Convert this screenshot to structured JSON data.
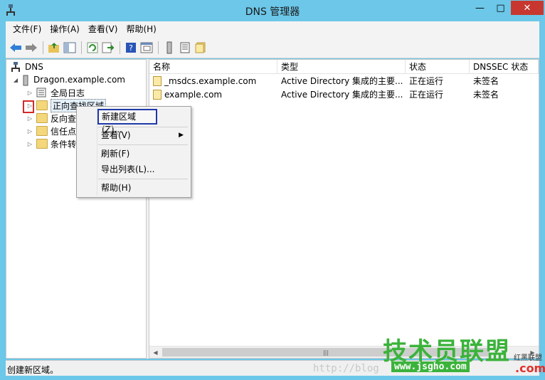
{
  "window": {
    "title": "DNS 管理器",
    "minimize": "—",
    "maximize": "□",
    "close": "✕"
  },
  "menubar": {
    "items": [
      "文件(F)",
      "操作(A)",
      "查看(V)",
      "帮助(H)"
    ]
  },
  "toolbar": {
    "icons": [
      "back-icon",
      "forward-icon",
      "up-folder-icon",
      "show-hide-tree-icon",
      "refresh-icon",
      "export-list-icon",
      "help-icon",
      "properties-icon",
      "server-icon",
      "list-icon",
      "folder-icon"
    ]
  },
  "tree": {
    "root": "DNS",
    "server": "Dragon.example.com",
    "children": [
      "全局日志",
      "正向查找区域",
      "反向查",
      "信任点",
      "条件转"
    ]
  },
  "list": {
    "columns": [
      "名称",
      "类型",
      "状态",
      "DNSSEC 状态"
    ],
    "rows": [
      {
        "name": "_msdcs.example.com",
        "type": "Active Directory 集成的主要...",
        "status": "正在运行",
        "dnssec": "未签名"
      },
      {
        "name": "example.com",
        "type": "Active Directory 集成的主要...",
        "status": "正在运行",
        "dnssec": "未签名"
      }
    ]
  },
  "context_menu": {
    "new_zone": "新建区域(Z)...",
    "view": "查看(V)",
    "refresh": "刷新(F)",
    "export_list": "导出列表(L)...",
    "help": "帮助(H)"
  },
  "statusbar": {
    "text": "创建新区域。",
    "watermark": "http://blog"
  },
  "watermark": {
    "main": "技术员联盟",
    "url": "www.jsgho.com",
    "side": "红黑联盟",
    "com": ".com"
  },
  "colors": {
    "titlebar": "#6cc7e8",
    "close": "#c7372f",
    "highlight_border": "#1f3aa8",
    "red_box": "#d22a2a"
  }
}
